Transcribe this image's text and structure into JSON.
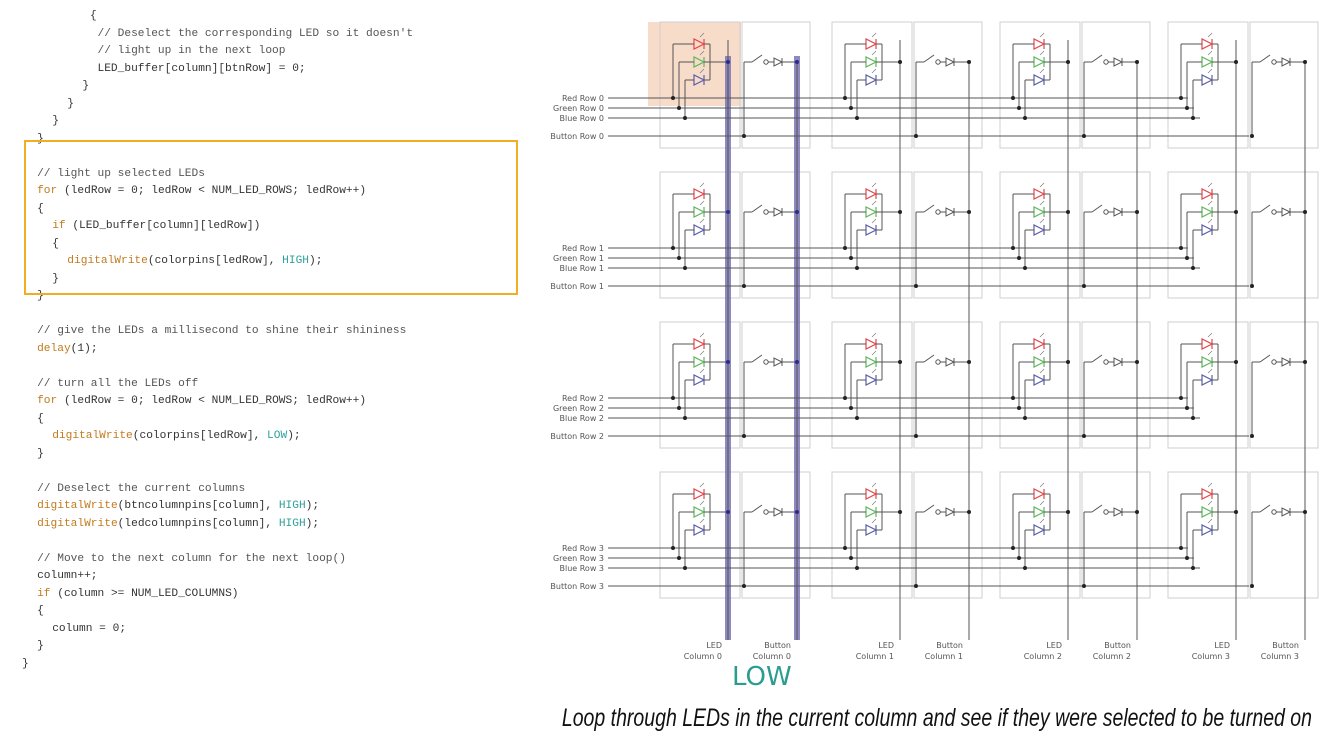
{
  "code": {
    "lines": [
      {
        "indent": 9,
        "tokens": [
          {
            "t": "{",
            "c": "plain"
          }
        ]
      },
      {
        "indent": 10,
        "tokens": [
          {
            "t": "// Deselect the corresponding LED so it doesn't",
            "c": "comment"
          }
        ]
      },
      {
        "indent": 10,
        "tokens": [
          {
            "t": "// light up in the next loop",
            "c": "comment"
          }
        ]
      },
      {
        "indent": 10,
        "tokens": [
          {
            "t": "LED_buffer[column][btnRow] = 0;",
            "c": "plain"
          }
        ]
      },
      {
        "indent": 8,
        "tokens": [
          {
            "t": "}",
            "c": "plain"
          }
        ]
      },
      {
        "indent": 6,
        "tokens": [
          {
            "t": "}",
            "c": "plain"
          }
        ]
      },
      {
        "indent": 4,
        "tokens": [
          {
            "t": "}",
            "c": "plain"
          }
        ]
      },
      {
        "indent": 2,
        "tokens": [
          {
            "t": "}",
            "c": "plain"
          }
        ]
      },
      {
        "indent": 0,
        "tokens": []
      },
      {
        "indent": 2,
        "tokens": [
          {
            "t": "// light up selected LEDs",
            "c": "comment"
          }
        ]
      },
      {
        "indent": 2,
        "tokens": [
          {
            "t": "for",
            "c": "kw"
          },
          {
            "t": " (ledRow = 0; ledRow < NUM_LED_ROWS; ledRow++)",
            "c": "plain"
          }
        ]
      },
      {
        "indent": 2,
        "tokens": [
          {
            "t": "{",
            "c": "plain"
          }
        ]
      },
      {
        "indent": 4,
        "tokens": [
          {
            "t": "if",
            "c": "kw"
          },
          {
            "t": " (LED_buffer[column][ledRow])",
            "c": "plain"
          }
        ]
      },
      {
        "indent": 4,
        "tokens": [
          {
            "t": "{",
            "c": "plain"
          }
        ]
      },
      {
        "indent": 6,
        "tokens": [
          {
            "t": "digitalWrite",
            "c": "fn"
          },
          {
            "t": "(colorpins[ledRow], ",
            "c": "plain"
          },
          {
            "t": "HIGH",
            "c": "const"
          },
          {
            "t": ");",
            "c": "plain"
          }
        ]
      },
      {
        "indent": 4,
        "tokens": [
          {
            "t": "}",
            "c": "plain"
          }
        ]
      },
      {
        "indent": 2,
        "tokens": [
          {
            "t": "}",
            "c": "plain"
          }
        ]
      },
      {
        "indent": 0,
        "tokens": []
      },
      {
        "indent": 2,
        "tokens": [
          {
            "t": "// give the LEDs a millisecond to shine their shininess",
            "c": "comment"
          }
        ]
      },
      {
        "indent": 2,
        "tokens": [
          {
            "t": "delay",
            "c": "fn"
          },
          {
            "t": "(1);",
            "c": "plain"
          }
        ]
      },
      {
        "indent": 0,
        "tokens": []
      },
      {
        "indent": 2,
        "tokens": [
          {
            "t": "// turn all the LEDs off",
            "c": "comment"
          }
        ]
      },
      {
        "indent": 2,
        "tokens": [
          {
            "t": "for",
            "c": "kw"
          },
          {
            "t": " (ledRow = 0; ledRow < NUM_LED_ROWS; ledRow++)",
            "c": "plain"
          }
        ]
      },
      {
        "indent": 2,
        "tokens": [
          {
            "t": "{",
            "c": "plain"
          }
        ]
      },
      {
        "indent": 4,
        "tokens": [
          {
            "t": "digitalWrite",
            "c": "fn"
          },
          {
            "t": "(colorpins[ledRow], ",
            "c": "plain"
          },
          {
            "t": "LOW",
            "c": "const"
          },
          {
            "t": ");",
            "c": "plain"
          }
        ]
      },
      {
        "indent": 2,
        "tokens": [
          {
            "t": "}",
            "c": "plain"
          }
        ]
      },
      {
        "indent": 0,
        "tokens": []
      },
      {
        "indent": 2,
        "tokens": [
          {
            "t": "// Deselect the current columns",
            "c": "comment"
          }
        ]
      },
      {
        "indent": 2,
        "tokens": [
          {
            "t": "digitalWrite",
            "c": "fn"
          },
          {
            "t": "(btncolumnpins[column], ",
            "c": "plain"
          },
          {
            "t": "HIGH",
            "c": "const"
          },
          {
            "t": ");",
            "c": "plain"
          }
        ]
      },
      {
        "indent": 2,
        "tokens": [
          {
            "t": "digitalWrite",
            "c": "fn"
          },
          {
            "t": "(ledcolumnpins[column], ",
            "c": "plain"
          },
          {
            "t": "HIGH",
            "c": "const"
          },
          {
            "t": ");",
            "c": "plain"
          }
        ]
      },
      {
        "indent": 0,
        "tokens": []
      },
      {
        "indent": 2,
        "tokens": [
          {
            "t": "// Move to the next column for the next loop()",
            "c": "comment"
          }
        ]
      },
      {
        "indent": 2,
        "tokens": [
          {
            "t": "column++;",
            "c": "plain"
          }
        ]
      },
      {
        "indent": 2,
        "tokens": [
          {
            "t": "if",
            "c": "kw"
          },
          {
            "t": " (column >= NUM_LED_COLUMNS)",
            "c": "plain"
          }
        ]
      },
      {
        "indent": 2,
        "tokens": [
          {
            "t": "{",
            "c": "plain"
          }
        ]
      },
      {
        "indent": 4,
        "tokens": [
          {
            "t": "column = 0;",
            "c": "plain"
          }
        ]
      },
      {
        "indent": 2,
        "tokens": [
          {
            "t": "}",
            "c": "plain"
          }
        ]
      },
      {
        "indent": 0,
        "tokens": [
          {
            "t": "}",
            "c": "plain"
          }
        ]
      }
    ]
  },
  "schematic": {
    "rows": [
      {
        "red": "Red Row 0",
        "green": "Green Row 0",
        "blue": "Blue Row 0",
        "button": "Button Row 0"
      },
      {
        "red": "Red Row 1",
        "green": "Green Row 1",
        "blue": "Blue Row 1",
        "button": "Button Row 1"
      },
      {
        "red": "Red Row 2",
        "green": "Green Row 2",
        "blue": "Blue Row 2",
        "button": "Button Row 2"
      },
      {
        "red": "Red Row 3",
        "green": "Green Row 3",
        "blue": "Blue Row 3",
        "button": "Button Row 3"
      }
    ],
    "columns": [
      {
        "led_top": "LED",
        "led_bottom": "Column 0",
        "btn_top": "Button",
        "btn_bottom": "Column 0"
      },
      {
        "led_top": "LED",
        "led_bottom": "Column 1",
        "btn_top": "Button",
        "btn_bottom": "Column 1"
      },
      {
        "led_top": "LED",
        "led_bottom": "Column 2",
        "btn_top": "Button",
        "btn_bottom": "Column 2"
      },
      {
        "led_top": "LED",
        "led_bottom": "Column 3",
        "btn_top": "Button",
        "btn_bottom": "Column 3"
      }
    ],
    "active_column": 0,
    "active_state_label": "LOW"
  },
  "caption": "Loop through LEDs in the current column and see if they were selected to be turned on",
  "colors": {
    "highlight_box": "#f2ae22",
    "active_column_bar": "#7a74b4",
    "selected_cell": "#f6d3bd",
    "led_red": "#e0474c",
    "led_green": "#5fb55f",
    "led_blue": "#5b5fa8",
    "low_label": "#2a9d8f"
  }
}
